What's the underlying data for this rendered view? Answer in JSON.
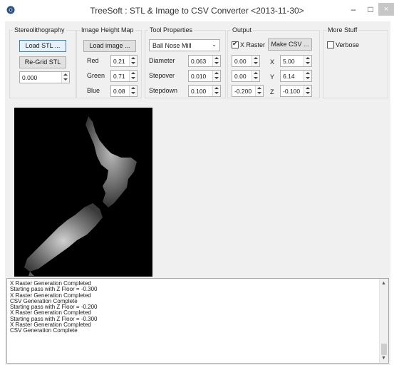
{
  "window": {
    "title": "TreeSoft : STL & Image to CSV Converter <2013-11-30>",
    "min_label": "–",
    "max_label": "□",
    "close_label": "×"
  },
  "stl": {
    "group_label": "Stereolithography",
    "load_label": "Load STL ...",
    "regrid_label": "Re-Grid STL",
    "value": "0.000"
  },
  "heightmap": {
    "group_label": "Image Height Map",
    "load_label": "Load image ...",
    "red_label": "Red",
    "red_value": "0.21",
    "green_label": "Green",
    "green_value": "0.71",
    "blue_label": "Blue",
    "blue_value": "0.08"
  },
  "tool": {
    "group_label": "Tool Properties",
    "type": "Ball Nose Mill",
    "diameter_label": "Diameter",
    "diameter_value": "0.063",
    "stepover_label": "Stepover",
    "stepover_value": "0.010",
    "stepdown_label": "Stepdown",
    "stepdown_value": "0.100"
  },
  "output": {
    "group_label": "Output",
    "xraster_label": "X Raster",
    "xraster_checked": true,
    "make_csv_label": "Make CSV ...",
    "origin_x": "0.00",
    "origin_y": "0.00",
    "origin_z": "-0.200",
    "x_label": "X",
    "x_value": "5.00",
    "y_label": "Y",
    "y_value": "6.14",
    "z_label": "Z",
    "z_value": "-0.100"
  },
  "more": {
    "group_label": "More Stuff",
    "verbose_label": "Verbose",
    "verbose_checked": false
  },
  "log": [
    "X Raster Generation Completed",
    "Starting pass with Z Floor = -0.300",
    "X Raster Generation Completed",
    "CSV Generation Complete",
    "Starting pass with Z Floor = -0.200",
    "X Raster Generation Completed",
    "Starting pass with Z Floor = -0.300",
    "X Raster Generation Completed",
    "CSV Generation Complete"
  ]
}
